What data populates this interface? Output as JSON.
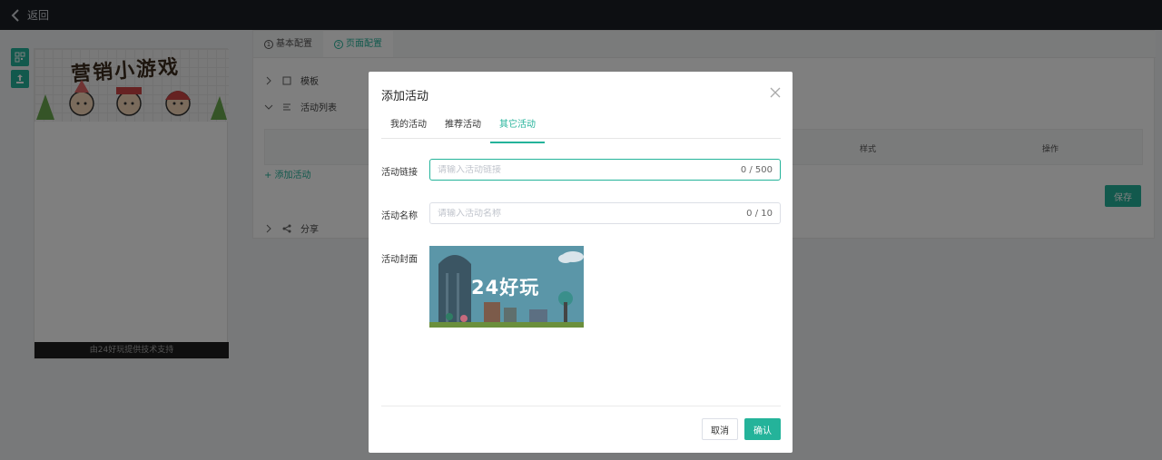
{
  "topbar": {
    "back_label": "返回"
  },
  "preview": {
    "banner_title": "营销小游戏",
    "footer": "由24好玩提供技术支持"
  },
  "editor": {
    "tabs": [
      {
        "num": "1",
        "label": "基本配置"
      },
      {
        "num": "2",
        "label": "页面配置"
      }
    ],
    "sections": {
      "template": "模板",
      "activity_list": "活动列表",
      "share": "分享"
    },
    "table_headers": {
      "style": "样式",
      "action": "操作"
    },
    "add_activity": "+ 添加活动",
    "save_label": "保存"
  },
  "modal": {
    "title": "添加活动",
    "tabs": [
      "我的活动",
      "推荐活动",
      "其它活动"
    ],
    "active_tab": "其它活动",
    "link": {
      "label": "活动链接",
      "placeholder": "请输入活动链接",
      "counter": "0 / 500"
    },
    "name": {
      "label": "活动名称",
      "placeholder": "请输入活动名称",
      "counter": "0 / 10"
    },
    "cover": {
      "label": "活动封面",
      "image_text": "24好玩"
    },
    "cancel_label": "取消",
    "confirm_label": "确认"
  },
  "colors": {
    "accent": "#24b39a",
    "topbar": "#1b1f24",
    "mask": "rgba(0,0,0,0.5)"
  }
}
